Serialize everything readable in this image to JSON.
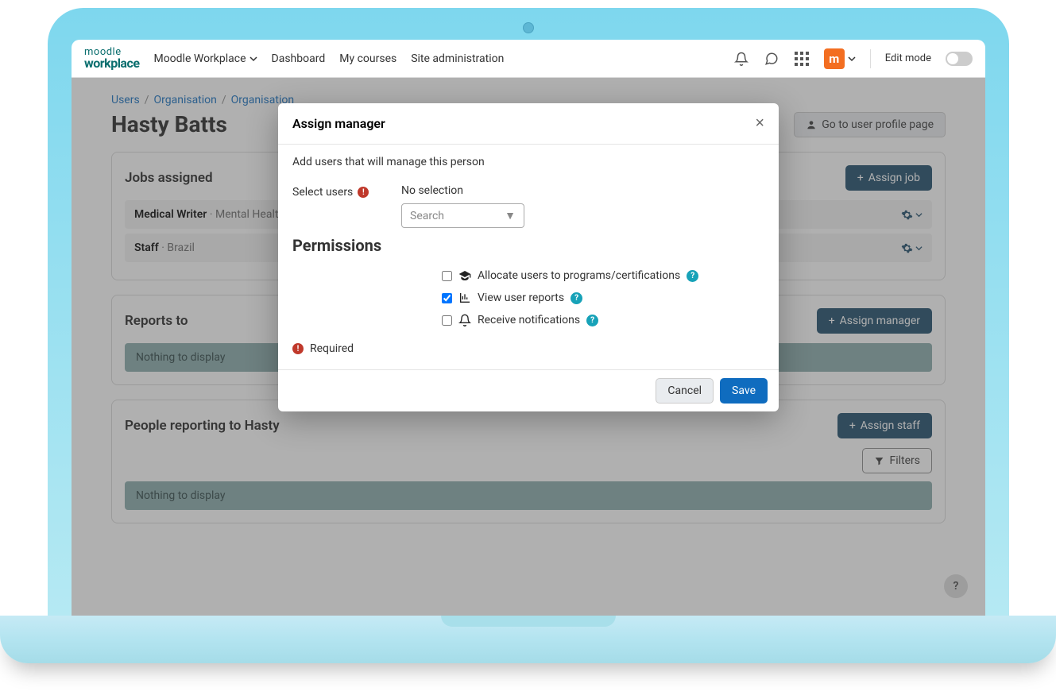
{
  "brand": {
    "line1": "moodle",
    "line2": "workplace"
  },
  "nav": {
    "workspace": "Moodle Workplace",
    "dashboard": "Dashboard",
    "mycourses": "My courses",
    "siteadmin": "Site administration",
    "editmode": "Edit mode"
  },
  "avatar_letter": "m",
  "breadcrumb": {
    "users": "Users",
    "organisation": "Organisation",
    "organisation2": "Organisation"
  },
  "page": {
    "title": "Hasty Batts",
    "profile_btn": "Go to user profile page"
  },
  "jobs": {
    "title": "Jobs assigned",
    "assign_btn": "Assign job",
    "rows": [
      {
        "title": "Medical Writer",
        "meta": "Mental Health"
      },
      {
        "title": "Staff",
        "meta": "Brazil"
      }
    ]
  },
  "reports": {
    "title": "Reports to",
    "assign_btn": "Assign manager",
    "empty": "Nothing to display"
  },
  "staff": {
    "title": "People reporting to Hasty",
    "assign_btn": "Assign staff",
    "filters": "Filters",
    "empty": "Nothing to display"
  },
  "help_fab": "?",
  "modal": {
    "title": "Assign manager",
    "desc": "Add users that will manage this person",
    "select_label": "Select users",
    "no_selection": "No selection",
    "search_placeholder": "Search",
    "permissions_title": "Permissions",
    "perms": [
      {
        "label": "Allocate users to programs/certifications",
        "checked": false,
        "icon": "graduation"
      },
      {
        "label": "View user reports",
        "checked": true,
        "icon": "chart"
      },
      {
        "label": "Receive notifications",
        "checked": false,
        "icon": "bell"
      }
    ],
    "required_note": "Required",
    "cancel": "Cancel",
    "save": "Save"
  }
}
